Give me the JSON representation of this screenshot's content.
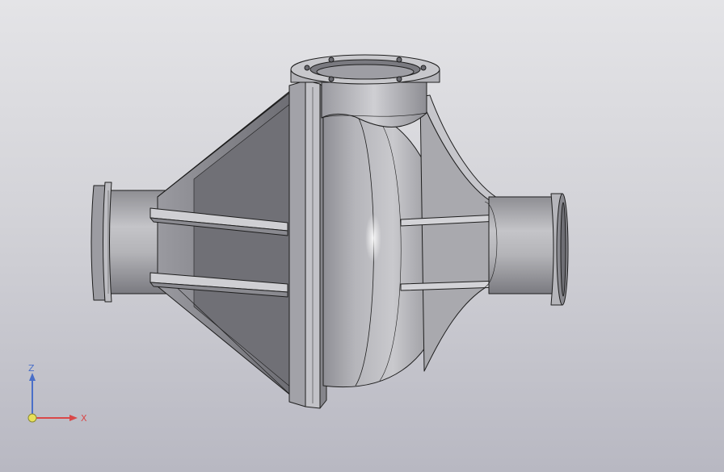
{
  "viewport": {
    "background_top": "#e4e4e7",
    "background_bottom": "#b8b8c2",
    "model": {
      "icon": "pipe-fitting-model",
      "body_color": "#a9a9ad",
      "edge_color": "#1e1e1e"
    },
    "triad": {
      "z_label": "Z",
      "x_label": "X",
      "z_color": "#4a6fc8",
      "x_color": "#d94848",
      "origin_color": "#e8e05a"
    }
  }
}
